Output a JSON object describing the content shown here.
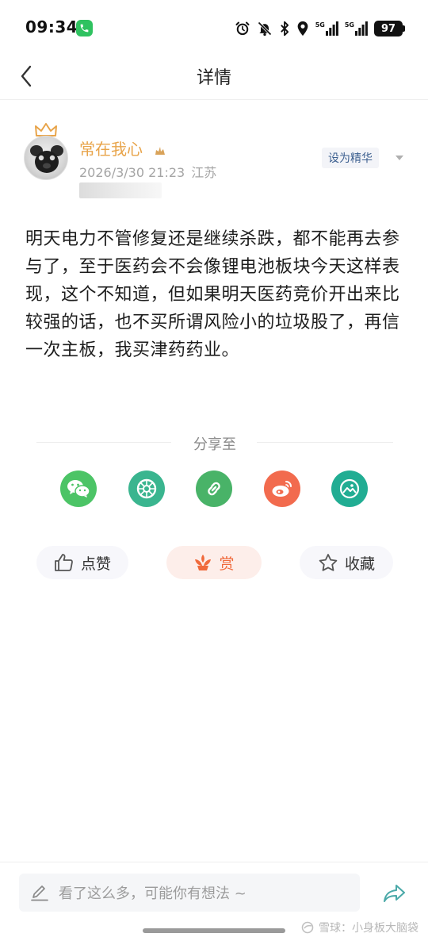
{
  "status_bar": {
    "time": "09:34",
    "net1": "5G",
    "net2": "5G",
    "battery": "97"
  },
  "nav": {
    "title": "详情"
  },
  "author": {
    "name": "常在我心",
    "timestamp": "2026/3/30 21:23",
    "location": "江苏",
    "essence_label": "设为精华"
  },
  "post": {
    "content": "明天电力不管修复还是继续杀跌，都不能再去参与了，至于医药会不会像锂电池板块今天这样表现，这个不知道，但如果明天医药竞价开出来比较强的话，也不买所谓风险小的垃圾股了，再信一次主板，我买津药药业。"
  },
  "share": {
    "label": "分享至",
    "targets": [
      {
        "icon": "wechat-icon",
        "color": "#4cc466"
      },
      {
        "icon": "moments-icon",
        "color": "#3ab58f"
      },
      {
        "icon": "link-icon",
        "color": "#49b368"
      },
      {
        "icon": "weibo-icon",
        "color": "#f26b4e"
      },
      {
        "icon": "image-icon",
        "color": "#21ad93"
      }
    ]
  },
  "actions": {
    "like": "点赞",
    "reward": "赏",
    "favorite": "收藏"
  },
  "comment_bar": {
    "placeholder": "看了这么多，可能你有想法 ~"
  },
  "watermark": "雪球：小身板大脑袋",
  "colors": {
    "author_name": "#e8a44a",
    "reward_accent": "#f06a3c",
    "essence_text": "#3c5f8f"
  }
}
